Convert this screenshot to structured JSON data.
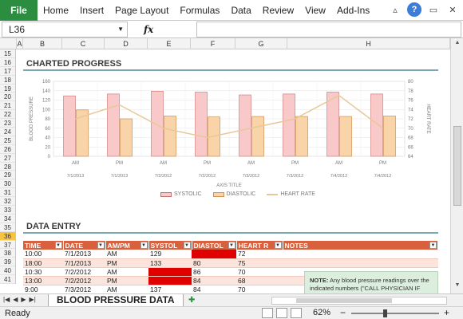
{
  "ribbon": {
    "file": "File",
    "tabs": [
      "Home",
      "Insert",
      "Page Layout",
      "Formulas",
      "Data",
      "Review",
      "View",
      "Add-Ins"
    ]
  },
  "formula_bar": {
    "cell": "L36",
    "fx": "fx",
    "value": ""
  },
  "columns": [
    "A",
    "B",
    "C",
    "D",
    "E",
    "F",
    "G",
    "H"
  ],
  "rows": [
    "15",
    "16",
    "17",
    "18",
    "19",
    "20",
    "21",
    "22",
    "23",
    "24",
    "25",
    "26",
    "27",
    "28",
    "29",
    "30",
    "31",
    "32",
    "33",
    "34",
    "35",
    "36",
    "37",
    "38",
    "39",
    "40",
    "41"
  ],
  "selected_row": "36",
  "charted_progress": {
    "title": "CHARTED PROGRESS",
    "y_left_label": "BLOOD PRESSURE",
    "y_right_label": "HEART RATE",
    "axis_title": "AXIS TITLE",
    "legend": [
      "SYSTOLIC",
      "DIASTOLIC",
      "HEART RATE"
    ]
  },
  "chart_data": {
    "type": "bar",
    "categories": [
      "AM",
      "PM",
      "AM",
      "PM",
      "AM",
      "PM",
      "AM",
      "PM"
    ],
    "dates": [
      "7/1/2013",
      "7/1/2013",
      "7/2/2012",
      "7/2/2012",
      "7/3/2012",
      "7/3/2012",
      "7/4/2012",
      "7/4/2012"
    ],
    "series": [
      {
        "name": "SYSTOLIC",
        "values": [
          129,
          133,
          139,
          137,
          131,
          133,
          137,
          133
        ]
      },
      {
        "name": "DIASTOLIC",
        "values": [
          99,
          80,
          86,
          84,
          85,
          85,
          85,
          86
        ]
      },
      {
        "name": "HEART RATE",
        "values": [
          72,
          75,
          70,
          68,
          70,
          72,
          77,
          70
        ],
        "axis": "right"
      }
    ],
    "ylim_left": [
      0,
      160
    ],
    "yticks_left": [
      0,
      20,
      40,
      60,
      80,
      100,
      120,
      140,
      160
    ],
    "ylim_right": [
      64,
      80
    ],
    "yticks_right": [
      64,
      66,
      68,
      70,
      72,
      74,
      76,
      78,
      80
    ],
    "xlabel": "AXIS TITLE",
    "ylabel_left": "BLOOD PRESSURE",
    "ylabel_right": "HEART RATE",
    "colors": {
      "systolic": "#f9c8c8",
      "diastolic": "#f8d4a8",
      "heart_rate": "#e8c898"
    }
  },
  "data_entry": {
    "title": "DATA ENTRY",
    "headers": [
      "TIME",
      "DATE",
      "AM/PM",
      "SYSTOL",
      "DIASTOL",
      "HEART R",
      "NOTES"
    ],
    "rows": [
      [
        "10:00",
        "7/1/2013",
        "AM",
        "129",
        "",
        "72"
      ],
      [
        "18:00",
        "7/1/2013",
        "PM",
        "133",
        "80",
        "75"
      ],
      [
        "10:30",
        "7/2/2012",
        "AM",
        "",
        "86",
        "70"
      ],
      [
        "13:00",
        "7/2/2012",
        "PM",
        "",
        "84",
        "68"
      ],
      [
        "9:00",
        "7/3/2012",
        "AM",
        "137",
        "84",
        "70"
      ]
    ],
    "note_label": "NOTE:",
    "note_text": "Any blood pressure readings over the indicated numbers (\"CALL PHYSICIAN IF"
  },
  "sheet_tab": "BLOOD PRESSURE DATA",
  "status": {
    "ready": "Ready",
    "zoom": "62%"
  }
}
